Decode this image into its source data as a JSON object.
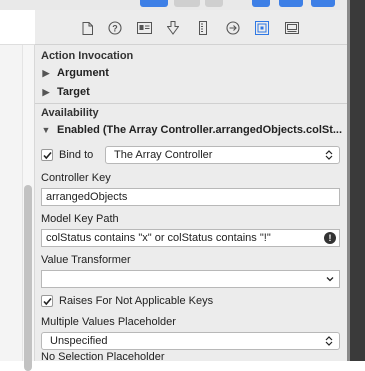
{
  "inspector": {
    "tabs": [
      {
        "name": "file-icon"
      },
      {
        "name": "help-icon"
      },
      {
        "name": "identity-icon"
      },
      {
        "name": "attributes-icon"
      },
      {
        "name": "size-icon"
      },
      {
        "name": "connections-icon"
      },
      {
        "name": "bindings-icon",
        "active": true
      },
      {
        "name": "effects-icon"
      }
    ],
    "action_invocation": {
      "title": "Action Invocation",
      "items": [
        "Argument",
        "Target"
      ]
    },
    "availability": {
      "title": "Availability",
      "enabled_row": "Enabled (The Array Controller.arrangedObjects.colSt...",
      "bind_to_label": "Bind to",
      "bind_to_value": "The Array Controller",
      "controller_key_label": "Controller Key",
      "controller_key_value": "arrangedObjects",
      "model_key_path_label": "Model Key Path",
      "model_key_path_value": "colStatus contains \"x\" or colStatus contains \"!\"",
      "value_transformer_label": "Value Transformer",
      "value_transformer_value": "",
      "raises_label": "Raises For Not Applicable Keys",
      "multiple_values_label": "Multiple Values Placeholder",
      "multiple_values_value": "Unspecified",
      "no_selection_label": "No Selection Placeholder"
    }
  },
  "colors": {
    "accent": "#2f78e4",
    "panel": "#ececec",
    "toolbar_button": "#3d7fe6"
  }
}
